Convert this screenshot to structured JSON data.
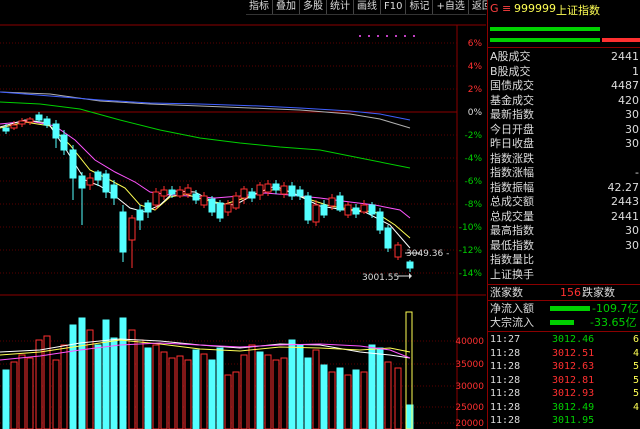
{
  "toolbar": {
    "items": [
      "指标",
      "叠加",
      "多股",
      "统计",
      "画线",
      "F10",
      "标记",
      "+自选",
      "返回"
    ]
  },
  "main_axis": {
    "ticks": [
      "6%",
      "4%",
      "2%",
      "0%",
      "-2%",
      "-4%",
      "-6%",
      "-8%",
      "-10%",
      "-12%",
      "-14%"
    ]
  },
  "annotations": {
    "high_label": "3049.36 -",
    "low_label": "3001.55"
  },
  "volume_axis": {
    "ticks": [
      "40000",
      "35000",
      "30000",
      "25000",
      "20000"
    ]
  },
  "panel": {
    "header_prefix": "G",
    "header_code": "999999",
    "header_name": "上证指数",
    "stats": [
      {
        "label": "A股成交",
        "value": "2441"
      },
      {
        "label": "B股成交",
        "value": "1"
      },
      {
        "label": "国债成交",
        "value": "4487"
      },
      {
        "label": "基金成交",
        "value": "420"
      },
      {
        "label": "最新指数",
        "value": "30"
      },
      {
        "label": "今日开盘",
        "value": "30"
      },
      {
        "label": "昨日收盘",
        "value": "30"
      },
      {
        "label": "指数涨跌",
        "value": ""
      },
      {
        "label": "指数涨幅",
        "value": "-"
      },
      {
        "label": "指数振幅",
        "value": "42.27"
      },
      {
        "label": "总成交额",
        "value": "2443"
      },
      {
        "label": "总成交量",
        "value": "2441"
      },
      {
        "label": "最高指数",
        "value": "30"
      },
      {
        "label": "最低指数",
        "value": "30"
      },
      {
        "label": "指数量比",
        "value": ""
      },
      {
        "label": "上证换手",
        "value": ""
      }
    ],
    "breadth": {
      "up_label": "涨家数",
      "count": "156",
      "down_label": "跌家数"
    },
    "flows": [
      {
        "label": "净流入额",
        "value": "-109.7亿"
      },
      {
        "label": "大宗流入",
        "value": "-33.65亿"
      }
    ],
    "ticks": [
      {
        "time": "11:27",
        "price": "3012.46",
        "vol": "6"
      },
      {
        "time": "11:28",
        "price": "3012.51",
        "vol": "4"
      },
      {
        "time": "11:28",
        "price": "3012.63",
        "vol": "5"
      },
      {
        "time": "11:28",
        "price": "3012.81",
        "vol": "5"
      },
      {
        "time": "11:28",
        "price": "3012.93",
        "vol": "5"
      },
      {
        "time": "11:28",
        "price": "3012.49",
        "vol": "4"
      },
      {
        "time": "11:28",
        "price": "3011.95",
        "vol": ""
      }
    ]
  },
  "colors": {
    "up": "#ff3030",
    "down": "#54ffff",
    "ma_white": "#ffffff",
    "ma_yellow": "#ffff54",
    "ma_magenta": "#ff54ff",
    "ma_green": "#00d000",
    "ma_blue": "#4060ff",
    "ma_gray": "#b0b0b0",
    "grid": "#8b0000"
  }
}
